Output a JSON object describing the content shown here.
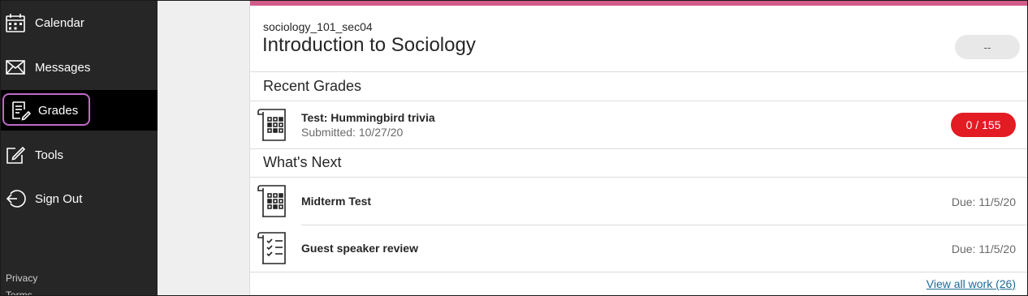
{
  "sidebar": {
    "items": [
      {
        "label": "Calendar",
        "icon": "calendar-icon"
      },
      {
        "label": "Messages",
        "icon": "envelope-icon"
      },
      {
        "label": "Grades",
        "icon": "grades-icon",
        "active": true
      },
      {
        "label": "Tools",
        "icon": "edit-square-icon"
      },
      {
        "label": "Sign Out",
        "icon": "sign-out-icon"
      }
    ],
    "footer": {
      "privacy": "Privacy",
      "terms": "Terms"
    }
  },
  "course": {
    "code": "sociology_101_sec04",
    "title": "Introduction to Sociology",
    "overall_grade": "--"
  },
  "recent_grades": {
    "heading": "Recent Grades",
    "items": [
      {
        "title": "Test: Hummingbird trivia",
        "submitted": "Submitted: 10/27/20",
        "score": "0 / 155",
        "icon": "test-icon"
      }
    ]
  },
  "whats_next": {
    "heading": "What's Next",
    "items": [
      {
        "title": "Midterm Test",
        "due": "Due: 11/5/20",
        "icon": "test-icon"
      },
      {
        "title": "Guest speaker review",
        "due": "Due: 11/5/20",
        "icon": "checklist-icon"
      }
    ]
  },
  "view_all": "View all work (26)",
  "colors": {
    "sidebar_bg": "#262626",
    "active_bg": "#000000",
    "active_ring": "#c06ac8",
    "accent_bar": "#d45a8a",
    "score_badge": "#e31b23",
    "link": "#1d6b98"
  }
}
